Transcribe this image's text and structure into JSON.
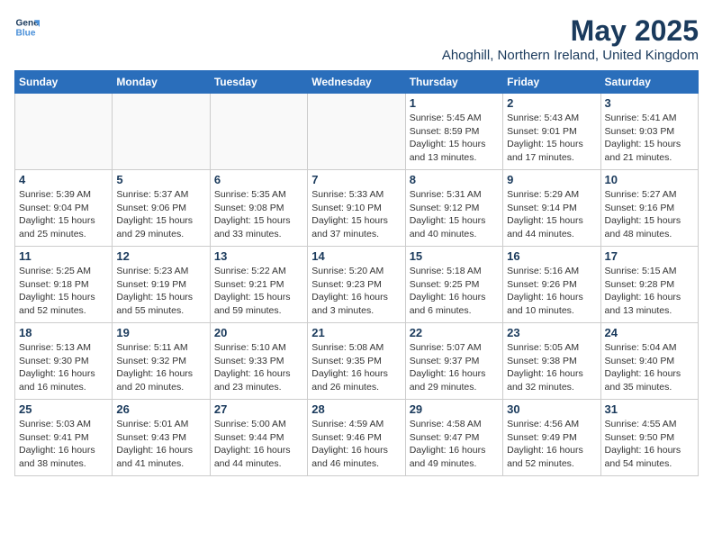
{
  "logo": {
    "line1": "General",
    "line2": "Blue"
  },
  "title": "May 2025",
  "subtitle": "Ahoghill, Northern Ireland, United Kingdom",
  "weekdays": [
    "Sunday",
    "Monday",
    "Tuesday",
    "Wednesday",
    "Thursday",
    "Friday",
    "Saturday"
  ],
  "weeks": [
    [
      {
        "day": "",
        "info": ""
      },
      {
        "day": "",
        "info": ""
      },
      {
        "day": "",
        "info": ""
      },
      {
        "day": "",
        "info": ""
      },
      {
        "day": "1",
        "info": "Sunrise: 5:45 AM\nSunset: 8:59 PM\nDaylight: 15 hours\nand 13 minutes."
      },
      {
        "day": "2",
        "info": "Sunrise: 5:43 AM\nSunset: 9:01 PM\nDaylight: 15 hours\nand 17 minutes."
      },
      {
        "day": "3",
        "info": "Sunrise: 5:41 AM\nSunset: 9:03 PM\nDaylight: 15 hours\nand 21 minutes."
      }
    ],
    [
      {
        "day": "4",
        "info": "Sunrise: 5:39 AM\nSunset: 9:04 PM\nDaylight: 15 hours\nand 25 minutes."
      },
      {
        "day": "5",
        "info": "Sunrise: 5:37 AM\nSunset: 9:06 PM\nDaylight: 15 hours\nand 29 minutes."
      },
      {
        "day": "6",
        "info": "Sunrise: 5:35 AM\nSunset: 9:08 PM\nDaylight: 15 hours\nand 33 minutes."
      },
      {
        "day": "7",
        "info": "Sunrise: 5:33 AM\nSunset: 9:10 PM\nDaylight: 15 hours\nand 37 minutes."
      },
      {
        "day": "8",
        "info": "Sunrise: 5:31 AM\nSunset: 9:12 PM\nDaylight: 15 hours\nand 40 minutes."
      },
      {
        "day": "9",
        "info": "Sunrise: 5:29 AM\nSunset: 9:14 PM\nDaylight: 15 hours\nand 44 minutes."
      },
      {
        "day": "10",
        "info": "Sunrise: 5:27 AM\nSunset: 9:16 PM\nDaylight: 15 hours\nand 48 minutes."
      }
    ],
    [
      {
        "day": "11",
        "info": "Sunrise: 5:25 AM\nSunset: 9:18 PM\nDaylight: 15 hours\nand 52 minutes."
      },
      {
        "day": "12",
        "info": "Sunrise: 5:23 AM\nSunset: 9:19 PM\nDaylight: 15 hours\nand 55 minutes."
      },
      {
        "day": "13",
        "info": "Sunrise: 5:22 AM\nSunset: 9:21 PM\nDaylight: 15 hours\nand 59 minutes."
      },
      {
        "day": "14",
        "info": "Sunrise: 5:20 AM\nSunset: 9:23 PM\nDaylight: 16 hours\nand 3 minutes."
      },
      {
        "day": "15",
        "info": "Sunrise: 5:18 AM\nSunset: 9:25 PM\nDaylight: 16 hours\nand 6 minutes."
      },
      {
        "day": "16",
        "info": "Sunrise: 5:16 AM\nSunset: 9:26 PM\nDaylight: 16 hours\nand 10 minutes."
      },
      {
        "day": "17",
        "info": "Sunrise: 5:15 AM\nSunset: 9:28 PM\nDaylight: 16 hours\nand 13 minutes."
      }
    ],
    [
      {
        "day": "18",
        "info": "Sunrise: 5:13 AM\nSunset: 9:30 PM\nDaylight: 16 hours\nand 16 minutes."
      },
      {
        "day": "19",
        "info": "Sunrise: 5:11 AM\nSunset: 9:32 PM\nDaylight: 16 hours\nand 20 minutes."
      },
      {
        "day": "20",
        "info": "Sunrise: 5:10 AM\nSunset: 9:33 PM\nDaylight: 16 hours\nand 23 minutes."
      },
      {
        "day": "21",
        "info": "Sunrise: 5:08 AM\nSunset: 9:35 PM\nDaylight: 16 hours\nand 26 minutes."
      },
      {
        "day": "22",
        "info": "Sunrise: 5:07 AM\nSunset: 9:37 PM\nDaylight: 16 hours\nand 29 minutes."
      },
      {
        "day": "23",
        "info": "Sunrise: 5:05 AM\nSunset: 9:38 PM\nDaylight: 16 hours\nand 32 minutes."
      },
      {
        "day": "24",
        "info": "Sunrise: 5:04 AM\nSunset: 9:40 PM\nDaylight: 16 hours\nand 35 minutes."
      }
    ],
    [
      {
        "day": "25",
        "info": "Sunrise: 5:03 AM\nSunset: 9:41 PM\nDaylight: 16 hours\nand 38 minutes."
      },
      {
        "day": "26",
        "info": "Sunrise: 5:01 AM\nSunset: 9:43 PM\nDaylight: 16 hours\nand 41 minutes."
      },
      {
        "day": "27",
        "info": "Sunrise: 5:00 AM\nSunset: 9:44 PM\nDaylight: 16 hours\nand 44 minutes."
      },
      {
        "day": "28",
        "info": "Sunrise: 4:59 AM\nSunset: 9:46 PM\nDaylight: 16 hours\nand 46 minutes."
      },
      {
        "day": "29",
        "info": "Sunrise: 4:58 AM\nSunset: 9:47 PM\nDaylight: 16 hours\nand 49 minutes."
      },
      {
        "day": "30",
        "info": "Sunrise: 4:56 AM\nSunset: 9:49 PM\nDaylight: 16 hours\nand 52 minutes."
      },
      {
        "day": "31",
        "info": "Sunrise: 4:55 AM\nSunset: 9:50 PM\nDaylight: 16 hours\nand 54 minutes."
      }
    ]
  ]
}
